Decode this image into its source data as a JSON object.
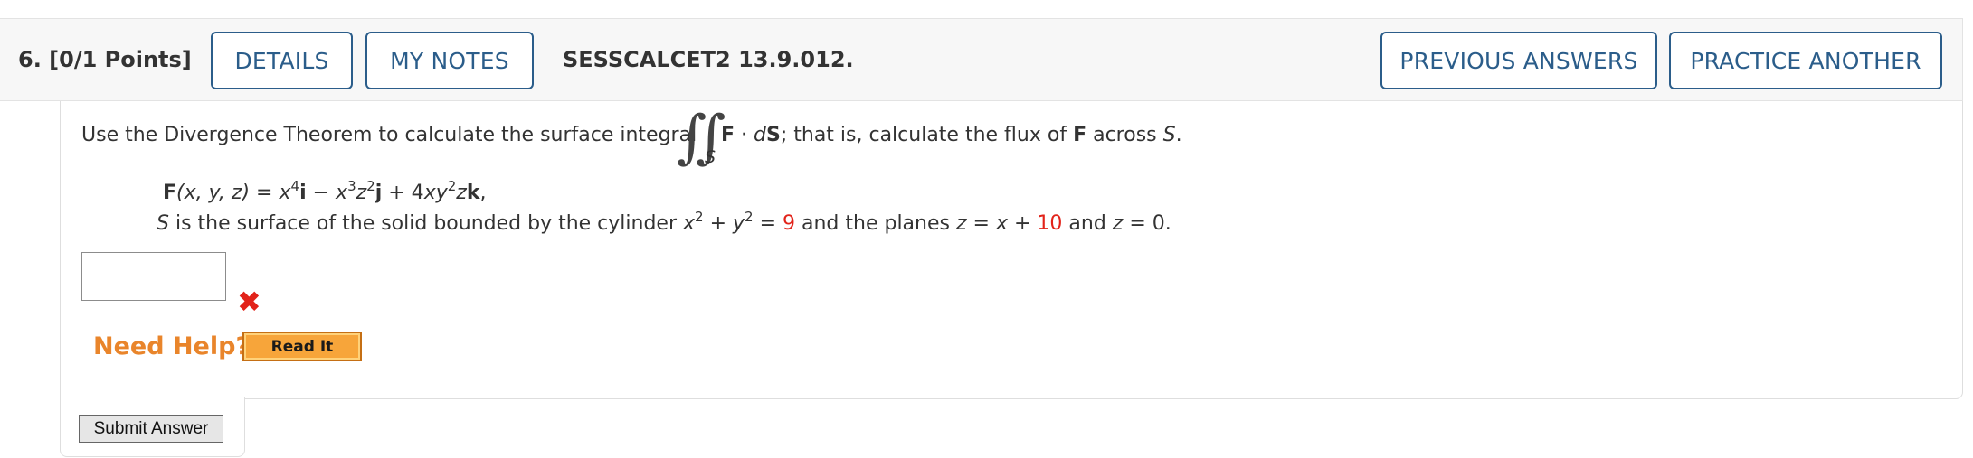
{
  "header": {
    "question_label": "6.  [0/1 Points]",
    "details_label": "DETAILS",
    "my_notes_label": "MY NOTES",
    "assignment_code": "SESSCALCET2 13.9.012.",
    "previous_answers_label": "PREVIOUS ANSWERS",
    "practice_another_label": "PRACTICE ANOTHER"
  },
  "question": {
    "intro_text": "Use the Divergence Theorem to calculate the surface integral",
    "integral_symbol": "∬",
    "integral_subscript": "S",
    "integrand_F": "F",
    "integrand_dot": " · ",
    "integrand_d": "d",
    "integrand_S": "S",
    "after_integral": ";  that is, calculate the flux of ",
    "flux_F": "F",
    "across_text": " across ",
    "across_S": "S",
    "period": ".",
    "field": {
      "F": "F",
      "args": "(x, y, z)",
      "eq": " = ",
      "t1_base": "x",
      "t1_exp": "4",
      "t1_vec": "i",
      "minus": " − ",
      "t2_x": "x",
      "t2_x_exp": "3",
      "t2_z": "z",
      "t2_z_exp": "2",
      "t2_vec": "j",
      "plus": " + 4",
      "t3_x": "x",
      "t3_y": "y",
      "t3_y_exp": "2",
      "t3_z": "z",
      "t3_vec": "k",
      "comma": ","
    },
    "surface": {
      "S": "S",
      "text1": " is the surface of the solid bounded by the cylinder  ",
      "x": "x",
      "x_exp": "2",
      "plus": " + ",
      "y": "y",
      "y_exp": "2",
      "eq": " = ",
      "radius_sq": "9",
      "text2": "  and the planes  ",
      "z1": "z",
      "eq2": " = ",
      "x2": "x",
      "plus2": " + ",
      "offset": "10",
      "and": " and ",
      "z2": "z",
      "eq3": " = 0."
    }
  },
  "answer": {
    "value": "",
    "status_icon": "✖",
    "status": "incorrect"
  },
  "help": {
    "need_help_label": "Need Help?",
    "read_it_label": "Read It"
  },
  "submit_label": "Submit Answer",
  "colors": {
    "accent_blue": "#2b5d8a",
    "highlight_red": "#e2231a",
    "help_orange": "#e9852b"
  }
}
